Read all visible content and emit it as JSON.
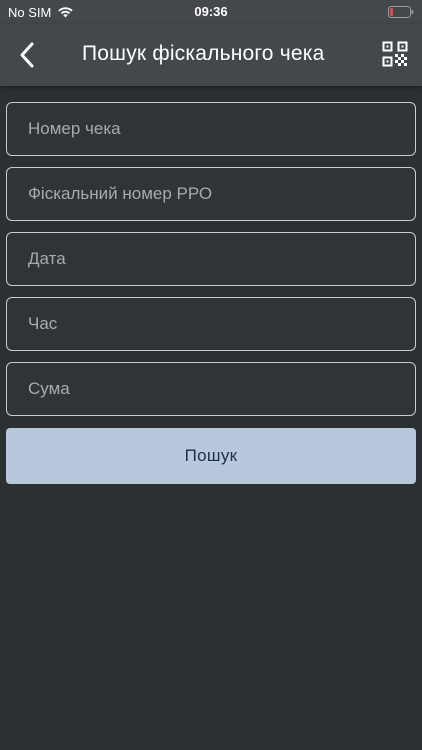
{
  "status_bar": {
    "carrier": "No SIM",
    "time": "09:36",
    "wifi_icon": "wifi-icon",
    "battery_icon": "battery-icon",
    "battery_color": "#e24b4b"
  },
  "nav": {
    "back_icon": "chevron-left-icon",
    "title": "Пошук фіскального чека",
    "qr_icon": "qr-code-icon"
  },
  "form": {
    "fields": [
      {
        "placeholder": "Номер чека",
        "value": ""
      },
      {
        "placeholder": "Фіскальний номер РРО",
        "value": ""
      },
      {
        "placeholder": "Дата",
        "value": ""
      },
      {
        "placeholder": "Час",
        "value": ""
      },
      {
        "placeholder": "Сума",
        "value": ""
      }
    ],
    "search_label": "Пошук"
  },
  "colors": {
    "background": "#2c3033",
    "header": "#44484b",
    "button_fill": "#b8c8dc",
    "button_text": "#1f3144",
    "field_border": "#c8ccd1"
  }
}
